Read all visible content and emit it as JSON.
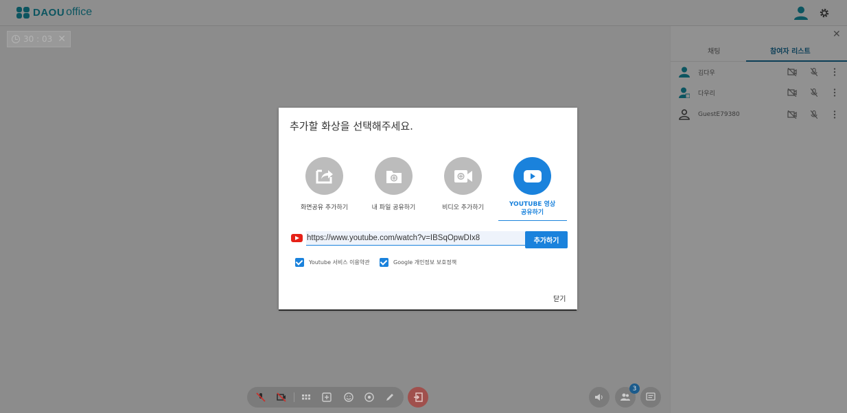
{
  "header": {
    "logo_strong": "DAOU",
    "logo_light": "office"
  },
  "timer": {
    "value": "30 : 03"
  },
  "side_panel": {
    "tabs": [
      {
        "label": "채팅",
        "active": false
      },
      {
        "label": "참여자 리스트",
        "active": true
      }
    ],
    "participants": [
      {
        "name": "김다우",
        "avatar": "user-filled-icon"
      },
      {
        "name": "다우리",
        "avatar": "user-host-icon"
      },
      {
        "name": "GuestE79380",
        "avatar": "user-outline-icon"
      }
    ]
  },
  "toolbar": {
    "participant_count": "3"
  },
  "modal": {
    "title": "추가할 화상을 선택해주세요.",
    "options": [
      {
        "label": "화면공유 추가하기",
        "icon": "screen-share-icon",
        "active": false
      },
      {
        "label": "내 파일 공유하기",
        "icon": "file-share-icon",
        "active": false
      },
      {
        "label": "비디오 추가하기",
        "icon": "video-add-icon",
        "active": false
      },
      {
        "label": "YOUTUBE 영상\n공유하기",
        "icon": "youtube-play-icon",
        "active": true
      }
    ],
    "url_value": "https://www.youtube.com/watch?v=IBSqOpwDIx8",
    "add_button": "추가하기",
    "checkboxes": [
      {
        "label": "Youtube 서비스 이용약관",
        "checked": true
      },
      {
        "label": "Google 개인정보 보호정책",
        "checked": true
      }
    ],
    "close_label": "닫기"
  },
  "colors": {
    "accent": "#1a82dc",
    "brand": "#0c5560",
    "youtube_red": "#e62117"
  }
}
